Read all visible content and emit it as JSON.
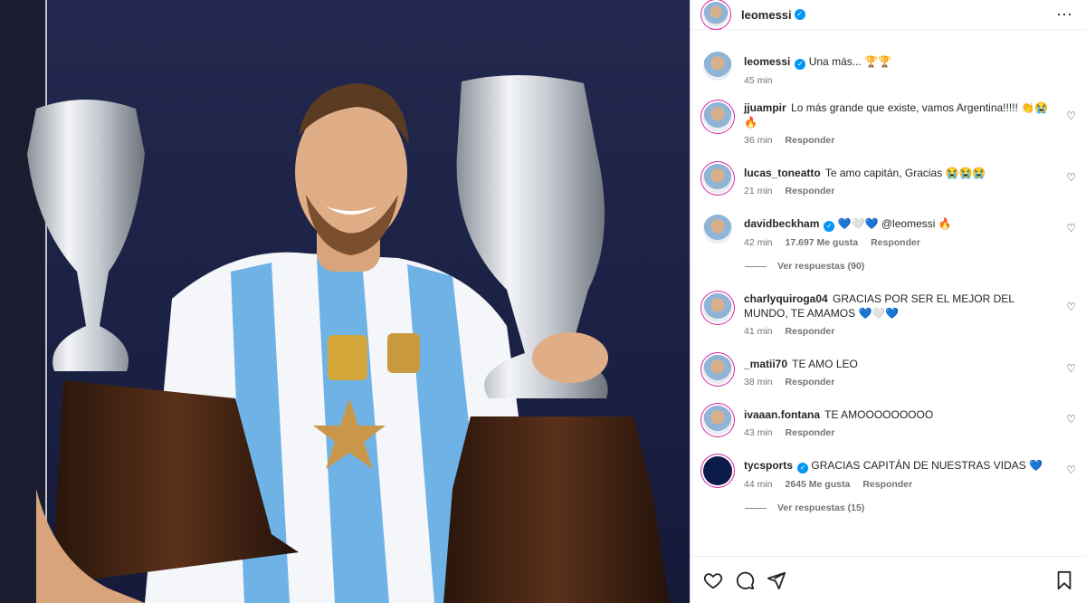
{
  "post": {
    "username": "leomessi",
    "caption": "Una más... 🏆🏆",
    "time": "45 min"
  },
  "comments": [
    {
      "user": "jjuampir",
      "text": "Lo más grande que existe, vamos Argentina!!!!! 👏😭 🔥",
      "time": "36 min",
      "likes": "",
      "reply": "Responder"
    },
    {
      "user": "lucas_toneatto",
      "text": "Te amo capitán, Gracias 😭😭😭",
      "time": "21 min",
      "likes": "",
      "reply": "Responder"
    },
    {
      "user": "davidbeckham",
      "text": "💙🤍💙 @leomessi 🔥",
      "time": "42 min",
      "likes": "17.697 Me gusta",
      "reply": "Responder",
      "replies": "Ver respuestas (90)"
    },
    {
      "user": "charlyquiroga04",
      "text": "GRACIAS POR SER EL MEJOR DEL MUNDO, TE AMAMOS 💙🤍💙",
      "time": "41 min",
      "likes": "",
      "reply": "Responder"
    },
    {
      "user": "_matii70",
      "text": "TE AMO LEO",
      "time": "38 min",
      "likes": "",
      "reply": "Responder"
    },
    {
      "user": "ivaaan.fontana",
      "text": "TE AMOOOOOOOOO",
      "time": "43 min",
      "likes": "",
      "reply": "Responder"
    },
    {
      "user": "tycsports",
      "text": "GRACIAS CAPITÁN DE NUESTRAS VIDAS 💙",
      "time": "44 min",
      "likes": "2645 Me gusta",
      "reply": "Responder",
      "replies": "Ver respuestas (15)"
    }
  ],
  "icons": {
    "more": "⋯",
    "verified": "✓",
    "heart": "♡"
  },
  "colors": {
    "verified": "#0095f6",
    "story_ring": "#d6249f"
  }
}
